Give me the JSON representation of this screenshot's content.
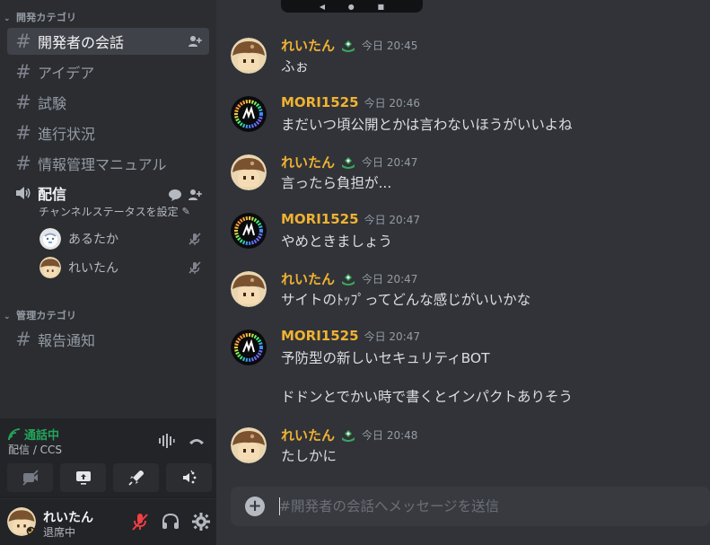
{
  "sidebar": {
    "categories": [
      {
        "label": "開発カテゴリ"
      },
      {
        "label": "管理カテゴリ"
      }
    ],
    "channels": [
      {
        "label": "開発者の会話",
        "selected": true
      },
      {
        "label": "アイデア"
      },
      {
        "label": "試験"
      },
      {
        "label": "進行状況"
      },
      {
        "label": "情報管理マニュアル"
      }
    ],
    "voice_channel": {
      "label": "配信",
      "status": "チャンネルステータスを設定",
      "users": [
        {
          "name": "あるたか"
        },
        {
          "name": "れいたん"
        }
      ]
    },
    "admin_channels": [
      {
        "label": "報告通知"
      }
    ]
  },
  "voice_panel": {
    "status": "通話中",
    "sub": "配信 / CCS"
  },
  "user_panel": {
    "name": "れいたん",
    "status": "退席中"
  },
  "messages": [
    {
      "author": "れいたん",
      "color": "#f0b232",
      "time": "今日 20:45",
      "text": "ふぉ",
      "avatar": "mushroom",
      "badge": true
    },
    {
      "author": "MORI1525",
      "color": "#f0b232",
      "time": "今日 20:46",
      "text": "まだいつ頃公開とかは言わないほうがいいよね",
      "avatar": "ring",
      "badge": false
    },
    {
      "author": "れいたん",
      "color": "#f0b232",
      "time": "今日 20:47",
      "text": "言ったら負担が...",
      "avatar": "mushroom",
      "badge": true
    },
    {
      "author": "MORI1525",
      "color": "#f0b232",
      "time": "今日 20:47",
      "text": "やめときましょう",
      "avatar": "ring",
      "badge": false
    },
    {
      "author": "れいたん",
      "color": "#f0b232",
      "time": "今日 20:47",
      "text": "サイトのﾄｯﾌﾟってどんな感じがいいかな",
      "avatar": "mushroom",
      "badge": true
    },
    {
      "author": "MORI1525",
      "color": "#f0b232",
      "time": "今日 20:47",
      "text": "予防型の新しいセキュリティBOT",
      "text2": "ドドンとでかい時で書くとインパクトありそう",
      "avatar": "ring",
      "badge": false
    },
    {
      "author": "れいたん",
      "color": "#f0b232",
      "time": "今日 20:48",
      "text": "たしかに",
      "avatar": "mushroom",
      "badge": true
    }
  ],
  "composer": {
    "placeholder": "#開発者の会話へメッセージを送信"
  },
  "colors": {
    "accent_green": "#23a55a",
    "author_gold": "#f0b232",
    "danger_red": "#f23f43"
  }
}
